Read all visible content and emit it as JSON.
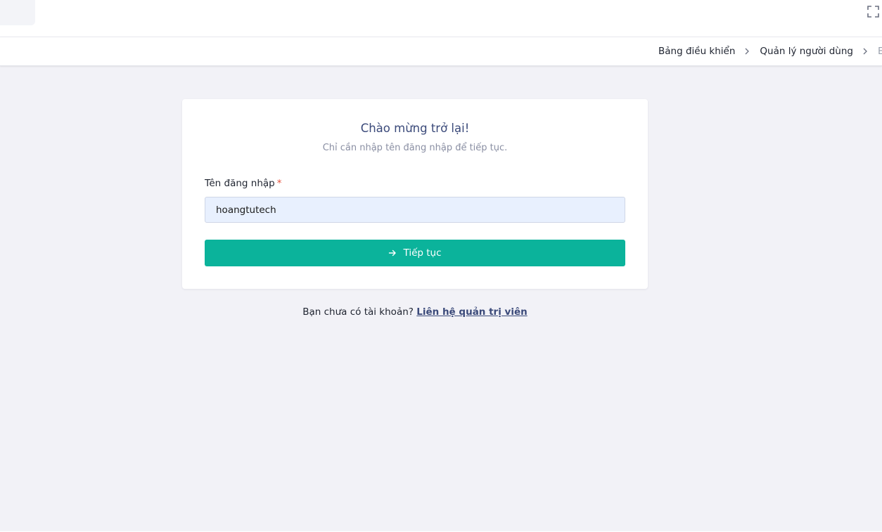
{
  "header": {
    "fullscreen_icon": "fullscreen-icon"
  },
  "breadcrumb": {
    "items": [
      "Bảng điều khiển",
      "Quản lý người dùng",
      "E"
    ],
    "separator_icon": "chevron-right-icon"
  },
  "login_card": {
    "title": "Chào mừng trở lại!",
    "subtitle": "Chỉ cần nhập tên đăng nhập để tiếp tục.",
    "username_label": "Tên đăng nhập",
    "required_mark": "*",
    "username_value": "hoangtutech",
    "continue_label": "Tiếp tục",
    "continue_icon": "arrow-right-icon"
  },
  "footer": {
    "prompt": "Bạn chưa có tài khoản?",
    "link_label": "Liên hệ quản trị viên"
  },
  "colors": {
    "accent": "#0bb39b",
    "title": "#3b4a7a",
    "input_background": "#e8f0fe",
    "page_background": "#f2f2f7",
    "required": "#e5533d"
  }
}
